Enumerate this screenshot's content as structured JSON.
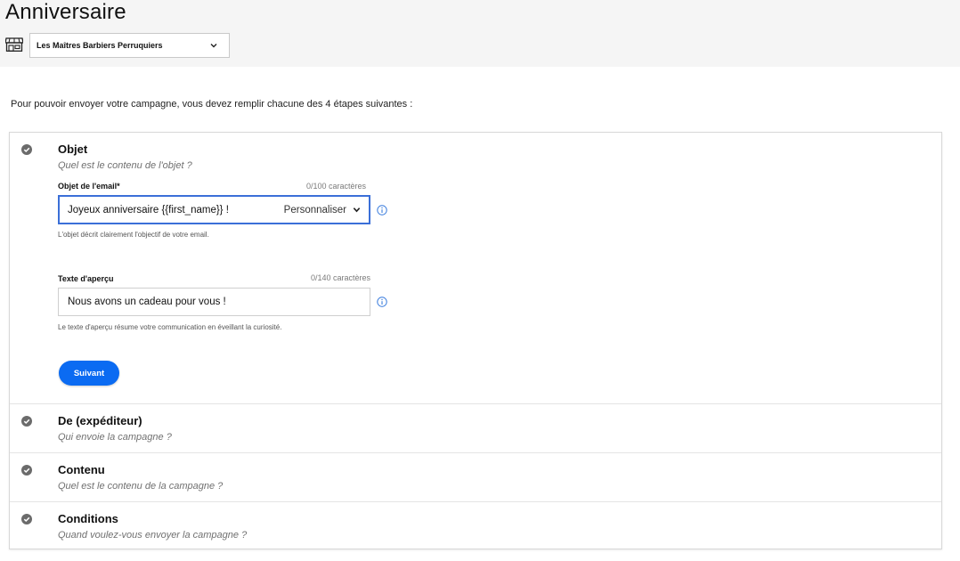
{
  "page": {
    "title": "Anniversaire",
    "store_select": {
      "value": "Les Maîtres Barbiers Perruquiers",
      "icon": "store-icon"
    },
    "intro": "Pour pouvoir envoyer votre campagne, vous devez remplir chacune des 4 étapes suivantes :"
  },
  "steps": {
    "objet": {
      "title": "Objet",
      "subtitle": "Quel est le contenu de l'objet ?",
      "subject_field": {
        "label": "Objet de l'email*",
        "count": "0/100 caractères",
        "value": "Joyeux anniversaire {{first_name}} !",
        "personalize_label": "Personnaliser",
        "help": "L'objet décrit clairement l'objectif de votre email."
      },
      "preview_field": {
        "label": "Texte d'aperçu",
        "count": "0/140 caractères",
        "value": "Nous avons un cadeau pour vous !",
        "help": "Le texte d'aperçu résume votre communication en éveillant la curiosité."
      },
      "next_label": "Suivant"
    },
    "de": {
      "title": "De (expéditeur)",
      "subtitle": "Qui envoie la campagne ?"
    },
    "contenu": {
      "title": "Contenu",
      "subtitle": "Quel est le contenu de la campagne ?"
    },
    "conditions": {
      "title": "Conditions",
      "subtitle": "Quand voulez-vous envoyer la campagne ?"
    }
  },
  "colors": {
    "accent": "#0b6bf2",
    "focus_border": "#3b6fd8",
    "info_icon": "#3b7ddd",
    "step_icon": "#6b6b6b",
    "topbar_bg": "#f5f5f5"
  }
}
